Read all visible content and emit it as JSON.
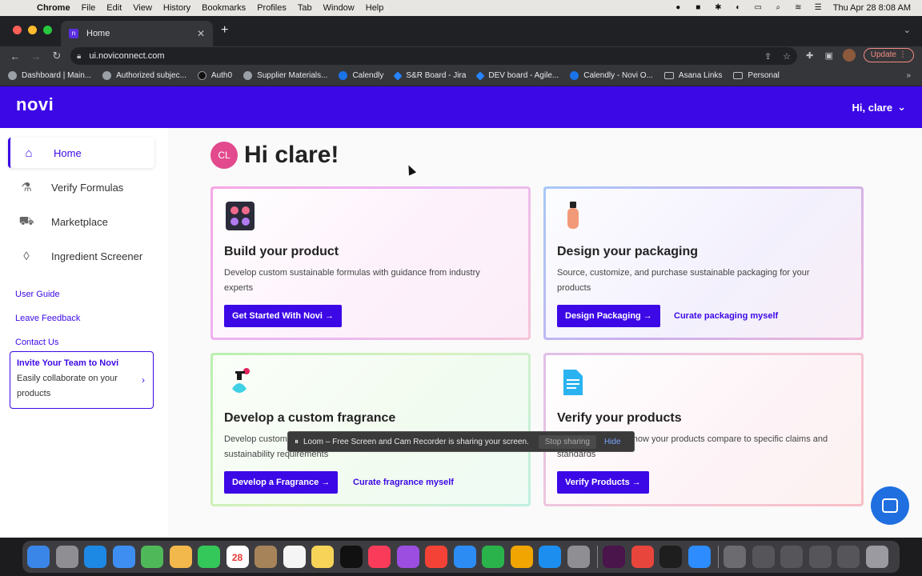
{
  "menubar": {
    "app_name": "Chrome",
    "items": [
      "File",
      "Edit",
      "View",
      "History",
      "Bookmarks",
      "Profiles",
      "Tab",
      "Window",
      "Help"
    ],
    "clock": "Thu Apr 28  8:08 AM"
  },
  "browser": {
    "tab_title": "Home",
    "tab_favicon": "n",
    "url": "ui.noviconnect.com",
    "update_label": "Update",
    "bookmarks": [
      {
        "label": "Dashboard | Main...",
        "icon": "globe-icon"
      },
      {
        "label": "Authorized subjec...",
        "icon": "globe-icon"
      },
      {
        "label": "Auth0",
        "icon": "auth0-icon"
      },
      {
        "label": "Supplier Materials...",
        "icon": "globe-icon"
      },
      {
        "label": "Calendly",
        "icon": "calendly-icon"
      },
      {
        "label": "S&R Board - Jira",
        "icon": "jira-icon"
      },
      {
        "label": "DEV board - Agile...",
        "icon": "jira-icon"
      },
      {
        "label": "Calendly - Novi O...",
        "icon": "calendly-icon"
      },
      {
        "label": "Asana Links",
        "icon": "folder-icon"
      },
      {
        "label": "Personal",
        "icon": "folder-icon"
      }
    ],
    "bookmarks_more": "»"
  },
  "app": {
    "logo": "novi",
    "greeting_menu": "Hi, clare",
    "brand_color": "#3c08e6",
    "sidebar": {
      "nav": [
        {
          "label": "Home",
          "icon": "home-icon",
          "active": true
        },
        {
          "label": "Verify Formulas",
          "icon": "flask-icon",
          "active": false
        },
        {
          "label": "Marketplace",
          "icon": "cart-icon",
          "active": false
        },
        {
          "label": "Ingredient Screener",
          "icon": "droplet-icon",
          "active": false
        }
      ],
      "links": [
        "User Guide",
        "Leave Feedback",
        "Contact Us"
      ],
      "invite": {
        "title": "Invite Your Team to Novi",
        "text": "Easily collaborate on your products"
      }
    },
    "main": {
      "avatar_initials": "CL",
      "title": "Hi clare!",
      "cards": [
        {
          "title": "Build your product",
          "description": "Develop custom sustainable formulas with guidance from industry experts",
          "button": "Get Started With Novi →",
          "link": ""
        },
        {
          "title": "Design your packaging",
          "description": "Source, customize, and purchase sustainable packaging for your products",
          "button": "Design Packaging →",
          "link": "Curate packaging myself"
        },
        {
          "title": "Develop a custom fragrance",
          "description": "Develop custom fragrances that meet your fragrance notes and sustainability requirements",
          "button": "Develop a Fragrance →",
          "link": "Curate fragrance myself"
        },
        {
          "title": "Verify your products",
          "description": "Discover and learn how your products compare to specific claims and standards",
          "button": "Verify Products →",
          "link": ""
        }
      ]
    },
    "loom_bar": {
      "message": "Loom – Free Screen and Cam Recorder is sharing your screen.",
      "stop": "Stop sharing",
      "hide": "Hide"
    }
  },
  "dock": {
    "calendar_day": "28",
    "calendar_month": "APR"
  }
}
